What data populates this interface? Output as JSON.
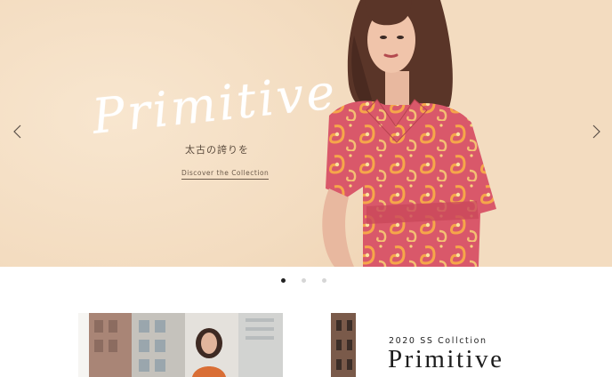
{
  "hero": {
    "title": "Primitive",
    "subtitle": "太古の誇りを",
    "link_label": "Discover the Collection",
    "arrow_left_icon": "chevron-left-icon",
    "arrow_right_icon": "chevron-right-icon",
    "background_color": "#f3dcc0"
  },
  "carousel": {
    "slide_count": 3,
    "active_index": 0,
    "active_color": "#222222",
    "inactive_color": "#d6d6d6"
  },
  "collection": {
    "label": "2020 SS Collction",
    "title": "Primitive"
  }
}
